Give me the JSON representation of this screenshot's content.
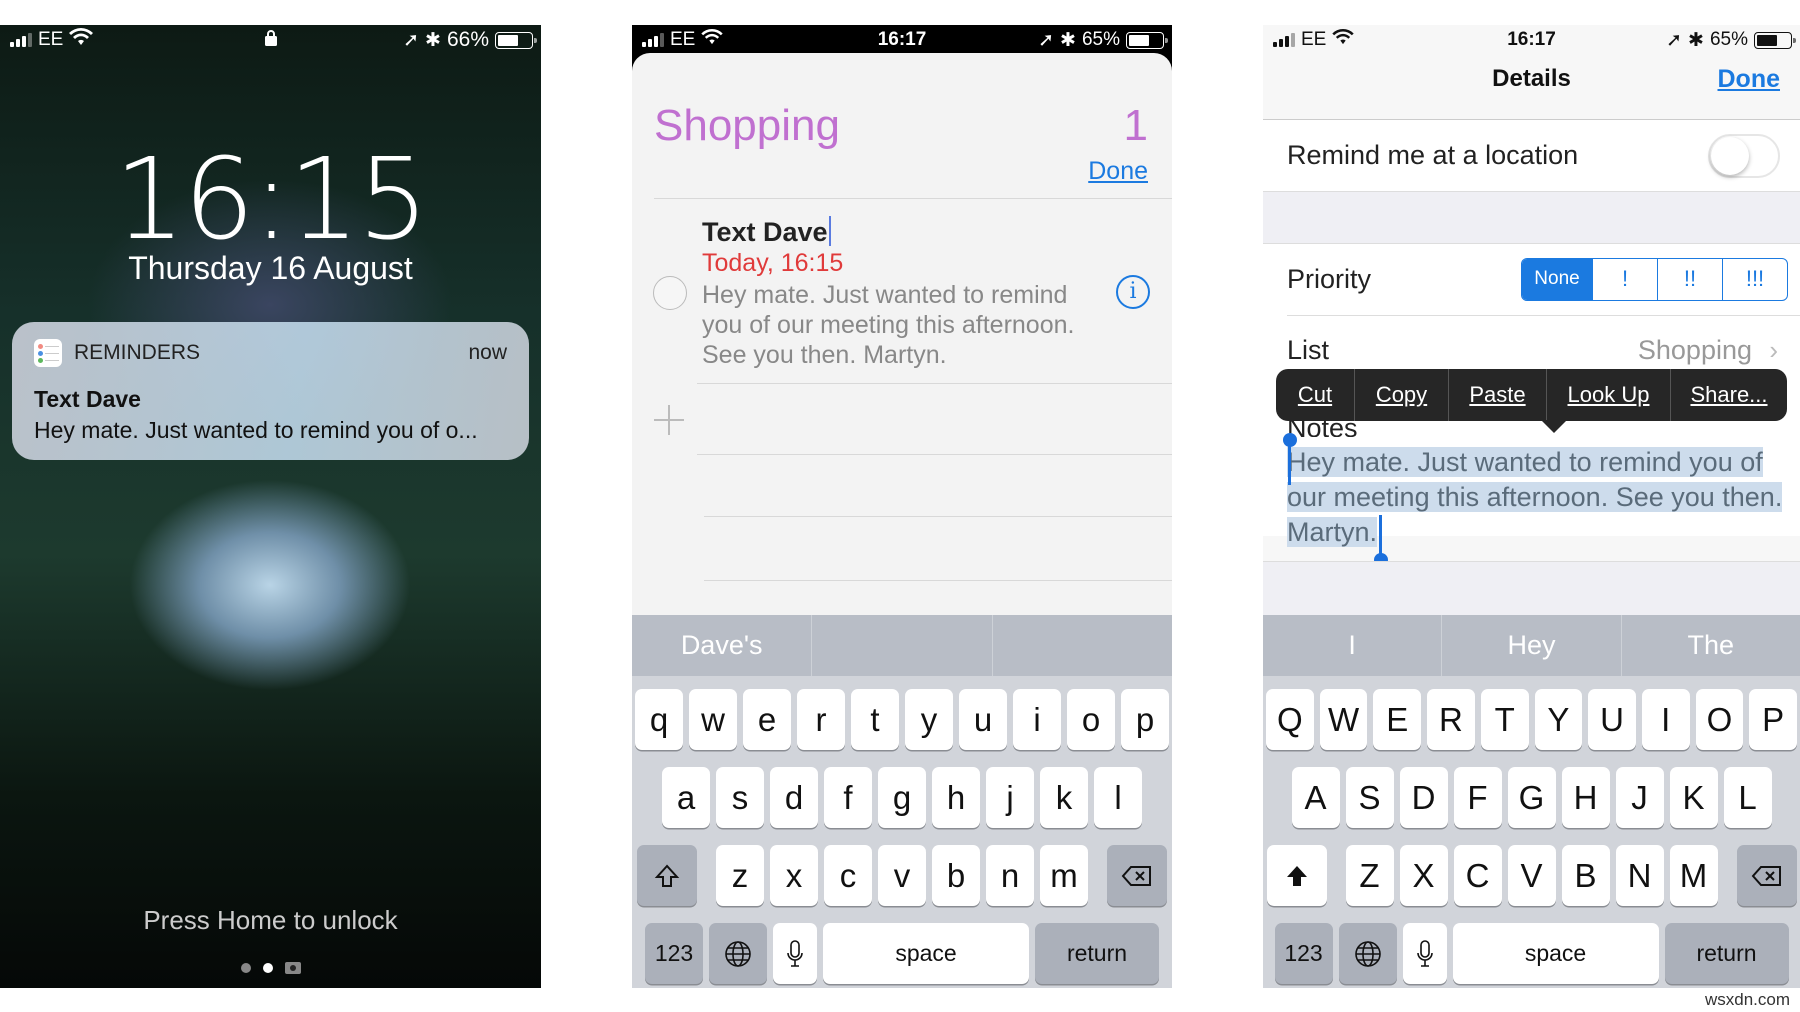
{
  "lock_screen": {
    "status": {
      "carrier": "EE",
      "battery": "66%",
      "battery_level": 0.66,
      "lock_icon": "lock-icon"
    },
    "time": "16:15",
    "date": "Thursday 16 August",
    "notification": {
      "app": "REMINDERS",
      "when": "now",
      "title": "Text Dave",
      "body": "Hey mate. Just wanted to remind you of o..."
    },
    "unlock_hint": "Press Home to unlock",
    "page_dots": {
      "count": 2,
      "active": 2
    }
  },
  "reminders_list": {
    "status": {
      "carrier": "EE",
      "time": "16:17",
      "battery": "65%",
      "battery_level": 0.65
    },
    "list_title": "Shopping",
    "count": "1",
    "done_label": "Done",
    "item": {
      "title": "Text Dave",
      "due": "Today, 16:15",
      "notes": "Hey mate. Just wanted to remind you of our meeting this afternoon. See you then.  Martyn."
    },
    "keyboard": {
      "predictions": [
        "Dave's",
        "",
        ""
      ],
      "row1": [
        "q",
        "w",
        "e",
        "r",
        "t",
        "y",
        "u",
        "i",
        "o",
        "p"
      ],
      "row2": [
        "a",
        "s",
        "d",
        "f",
        "g",
        "h",
        "j",
        "k",
        "l"
      ],
      "row3": [
        "z",
        "x",
        "c",
        "v",
        "b",
        "n",
        "m"
      ],
      "numbers": "123",
      "space": "space",
      "return": "return"
    }
  },
  "details": {
    "status": {
      "carrier": "EE",
      "time": "16:17",
      "battery": "65%",
      "battery_level": 0.65
    },
    "title": "Details",
    "done_label": "Done",
    "location_label": "Remind me at a location",
    "location_enabled": false,
    "priority_label": "Priority",
    "priority_options": [
      "None",
      "!",
      "!!",
      "!!!"
    ],
    "priority_selected": "None",
    "list_label": "List",
    "list_value": "Shopping",
    "notes_label": "Notes",
    "notes_text": "Hey mate. Just wanted to remind you of our meeting this afternoon. See you then. Martyn.",
    "context_menu": [
      "Cut",
      "Copy",
      "Paste",
      "Look Up",
      "Share..."
    ],
    "keyboard": {
      "predictions": [
        "I",
        "Hey",
        "The"
      ],
      "row1": [
        "Q",
        "W",
        "E",
        "R",
        "T",
        "Y",
        "U",
        "I",
        "O",
        "P"
      ],
      "row2": [
        "A",
        "S",
        "D",
        "F",
        "G",
        "H",
        "J",
        "K",
        "L"
      ],
      "row3": [
        "Z",
        "X",
        "C",
        "V",
        "B",
        "N",
        "M"
      ],
      "numbers": "123",
      "space": "space",
      "return": "return"
    }
  },
  "watermark": "wsxdn.com"
}
